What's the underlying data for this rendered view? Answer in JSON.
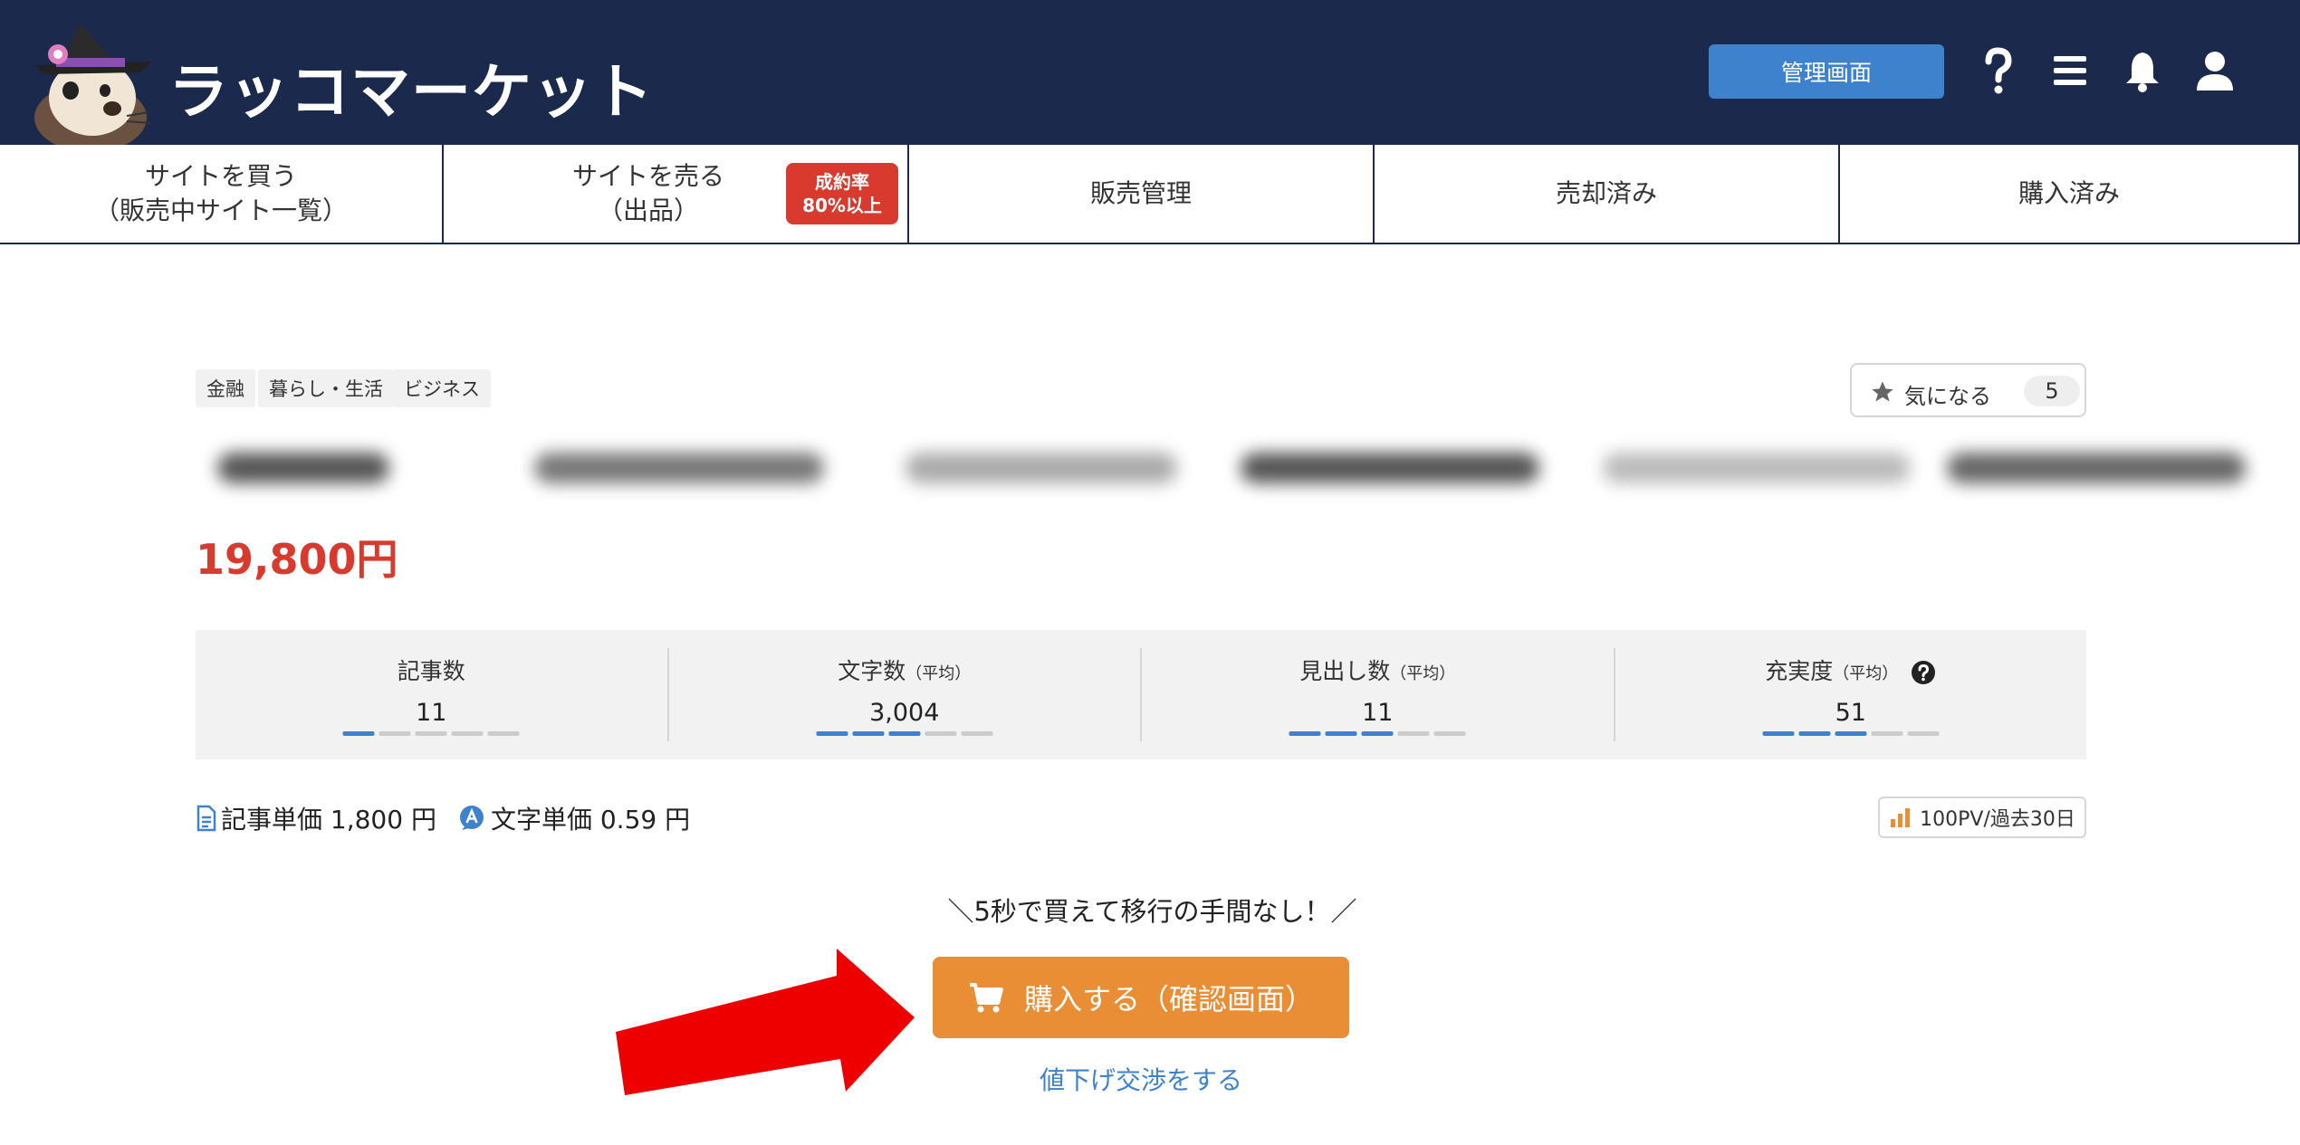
{
  "header": {
    "site_name": "ラッコマーケット",
    "admin_button": "管理画面",
    "icons": [
      "help-icon",
      "menu-icon",
      "bell-icon",
      "user-icon"
    ]
  },
  "nav": {
    "items": [
      {
        "line1": "サイトを買う",
        "line2": "（販売中サイト一覧）"
      },
      {
        "line1": "サイトを売る",
        "line2": "（出品）"
      },
      {
        "label": "販売管理"
      },
      {
        "label": "売却済み"
      },
      {
        "label": "購入済み"
      }
    ],
    "badge": {
      "line1": "成約率",
      "line2": "80%以上"
    }
  },
  "listing": {
    "tags": [
      "金融",
      "暮らし・生活",
      "ビジネス"
    ],
    "favorite": {
      "label": "気になる",
      "count": "5"
    },
    "price": "19,800円",
    "stats": [
      {
        "label": "記事数",
        "sub": "",
        "value": "11",
        "level": 1
      },
      {
        "label": "文字数",
        "sub": "（平均）",
        "value": "3,004",
        "level": 3
      },
      {
        "label": "見出し数",
        "sub": "（平均）",
        "value": "11",
        "level": 3
      },
      {
        "label": "充実度",
        "sub": "（平均）",
        "value": "51",
        "level": 3
      }
    ],
    "article_unit_price": "記事単価 1,800 円",
    "char_unit_price": "文字単価 0.59 円",
    "pv": "100PV/過去30日"
  },
  "purchase": {
    "catch": "＼5秒で買えて移行の手間なし！／",
    "buy_button": "購入する（確認画面）",
    "negotiate_link": "値下げ交渉をする"
  },
  "colors": {
    "header_bg": "#1b2a4c",
    "accent_blue": "#3e82cd",
    "price_red": "#d83a2e",
    "buy_orange": "#e98e35",
    "arrow_red": "#ee0000"
  }
}
